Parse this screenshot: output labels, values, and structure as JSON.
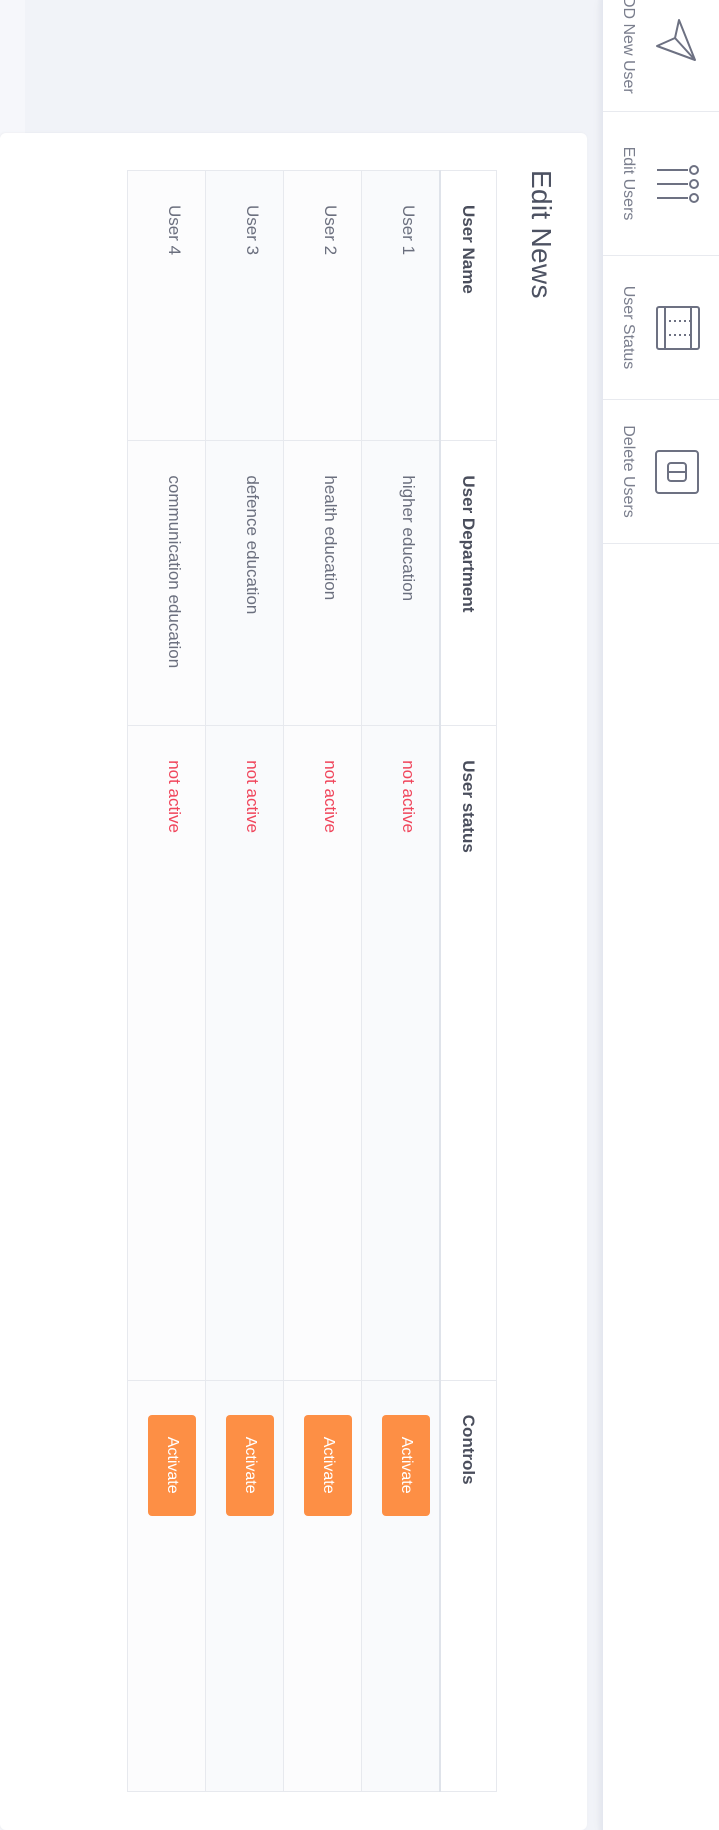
{
  "nav": {
    "items": [
      {
        "label": "ADD New User",
        "icon": "send-icon"
      },
      {
        "label": "Edit Users",
        "icon": "sliders-icon"
      },
      {
        "label": "User Status",
        "icon": "server-icon"
      },
      {
        "label": "Delete Users",
        "icon": "delete-icon"
      }
    ]
  },
  "card": {
    "title": "Edit News"
  },
  "table": {
    "headers": [
      "User Name",
      "User Department",
      "User status",
      "Controls"
    ],
    "rows": [
      {
        "name": "User 1",
        "department": "higher education",
        "status": "not active",
        "action": "Activate"
      },
      {
        "name": "User 2",
        "department": "health education",
        "status": "not active",
        "action": "Activate"
      },
      {
        "name": "User 3",
        "department": "defence education",
        "status": "not active",
        "action": "Activate"
      },
      {
        "name": "User 4",
        "department": "communication education",
        "status": "not active",
        "action": "Activate"
      }
    ]
  },
  "colors": {
    "accent": "#fd8f45",
    "status_inactive": "#f0455b",
    "background": "#f1f3f8"
  }
}
